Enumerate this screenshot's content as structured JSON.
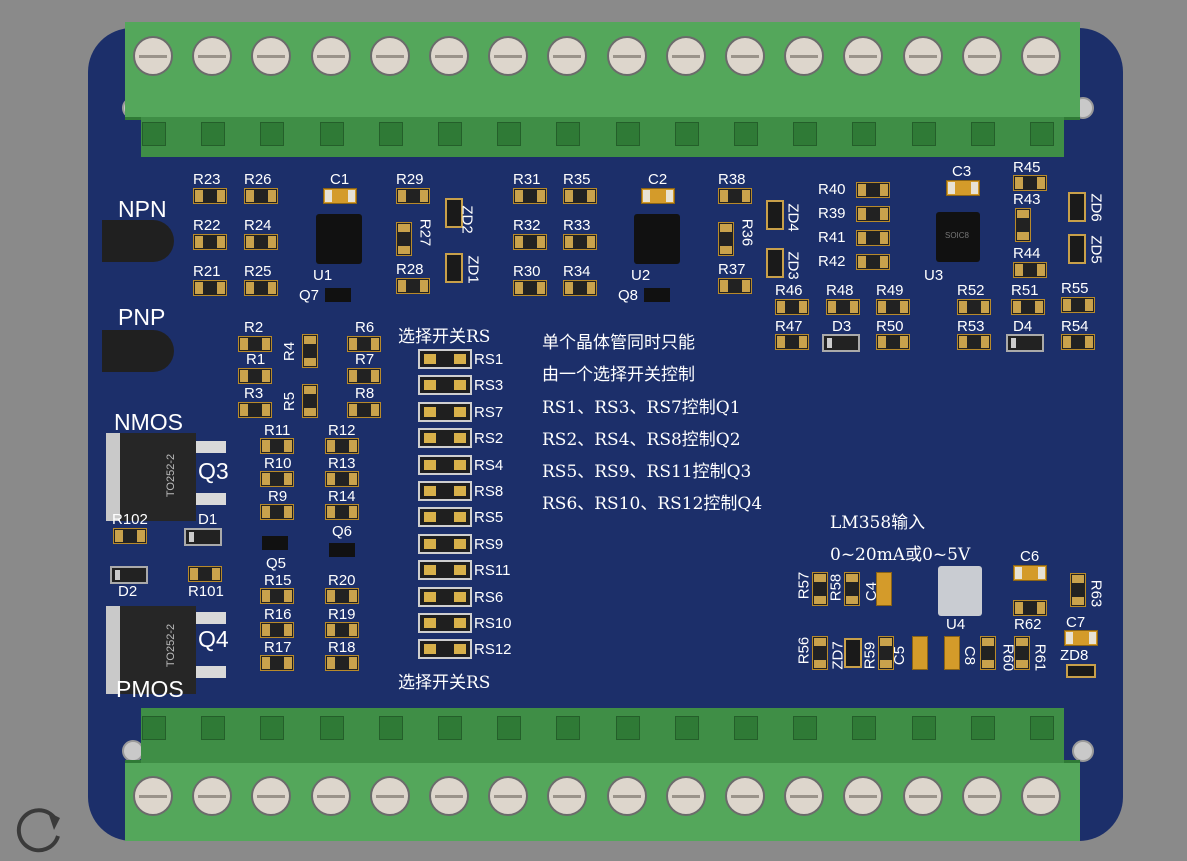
{
  "board": {
    "transistor_labels": {
      "npn": "NPN",
      "pnp": "PNP",
      "nmos": "NMOS",
      "pmos": "PMOS"
    },
    "package_labels": [
      "TO252-2",
      "TO252-2"
    ],
    "transistor_refs": {
      "q3": "Q3",
      "q4": "Q4",
      "q5": "Q5",
      "q6": "Q6",
      "q7": "Q7",
      "q8": "Q8"
    },
    "ic_refs": {
      "u1": "U1",
      "u2": "U2",
      "u3": "U3",
      "u4": "U4"
    },
    "ic_marking": "SOIC8",
    "diode_refs": {
      "d1": "D1",
      "d2": "D2",
      "d3": "D3",
      "d4": "D4"
    },
    "zener_refs": [
      "ZD1",
      "ZD2",
      "ZD3",
      "ZD4",
      "ZD5",
      "ZD6",
      "ZD7",
      "ZD8"
    ],
    "cap_refs": [
      "C1",
      "C2",
      "C3",
      "C4",
      "C5",
      "C6",
      "C7",
      "C8"
    ],
    "resistor_refs_left": [
      "R23",
      "R26",
      "R22",
      "R24",
      "R21",
      "R25",
      "R2",
      "R1",
      "R3",
      "R4",
      "R5",
      "R6",
      "R7",
      "R8",
      "R11",
      "R12",
      "R10",
      "R13",
      "R9",
      "R14",
      "R15",
      "R20",
      "R16",
      "R19",
      "R17",
      "R18",
      "R102",
      "R101"
    ],
    "resistor_refs_mid": [
      "R29",
      "R27",
      "R28",
      "R31",
      "R35",
      "R32",
      "R33",
      "R30",
      "R34",
      "R38",
      "R36",
      "R37"
    ],
    "resistor_refs_right": [
      "R40",
      "R39",
      "R41",
      "R42",
      "R45",
      "R43",
      "R44",
      "R46",
      "R48",
      "R49",
      "R52",
      "R51",
      "R55",
      "R47",
      "R50",
      "R53",
      "R54",
      "R57",
      "R58",
      "R56",
      "R59",
      "R60",
      "R61",
      "R62",
      "R63"
    ],
    "select_switch_title": "选择开关RS",
    "select_switch_footer": "选择开关RS",
    "switches": [
      "RS1",
      "RS3",
      "RS7",
      "RS2",
      "RS4",
      "RS8",
      "RS5",
      "RS9",
      "RS11",
      "RS6",
      "RS10",
      "RS12"
    ],
    "notes": [
      "单个晶体管同时只能",
      "由一个选择开关控制",
      "RS1、RS3、RS7控制Q1",
      "RS2、RS4、RS8控制Q2",
      "RS5、RS9、RS11控制Q3",
      "RS6、RS10、RS12控制Q4"
    ],
    "lm358_title": "LM358输入",
    "lm358_range": "0~20mA或0~5V",
    "terminal_count_top": 16,
    "terminal_count_bottom": 16
  },
  "colors": {
    "background": "#8a8a8a",
    "pcb": "#1c2f6a",
    "terminal_green": "#54a75b",
    "silkscreen": "#ffffff",
    "pad_gold": "#c9a24c"
  },
  "icons": {
    "rotate": "rotate-view-icon"
  }
}
